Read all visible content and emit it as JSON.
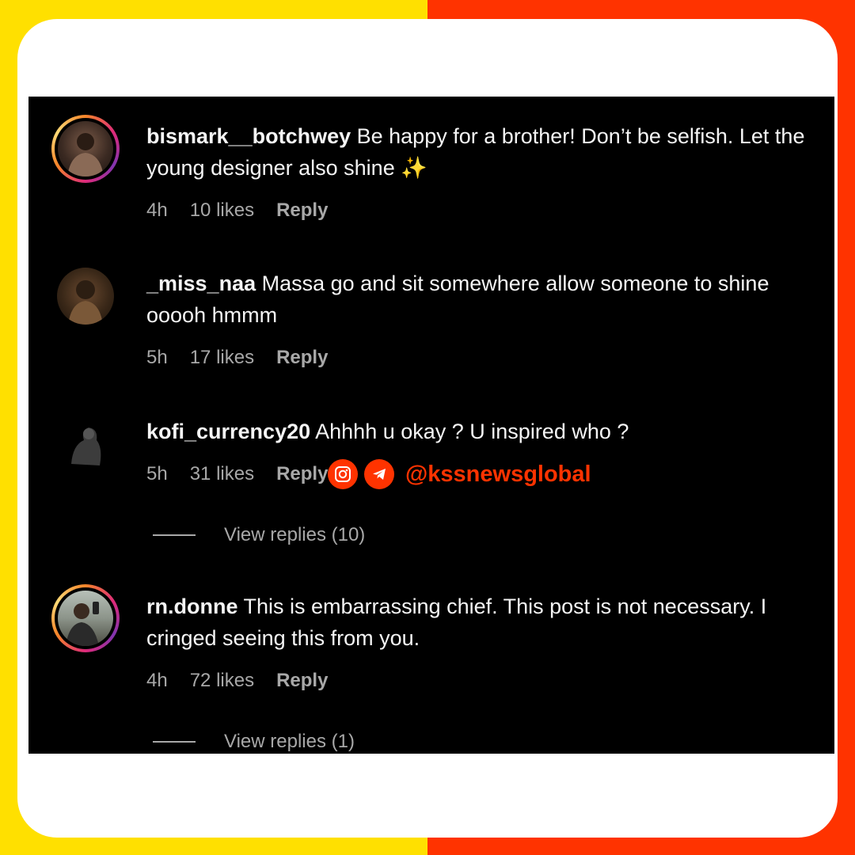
{
  "colors": {
    "left_background": "#FFE000",
    "right_background": "#FF3300",
    "accent": "#FF3300",
    "meta_text": "#a8a8a8"
  },
  "comments": [
    {
      "username": "bismark__botchwey",
      "text": "Be happy for a brother! Don’t be selfish. Let the young designer also shine ✨",
      "time": "4h",
      "likes": "10 likes",
      "reply": "Reply",
      "story_ring": true
    },
    {
      "username": "_miss_naa",
      "text": "Massa go and sit somewhere allow someone to shine ooooh hmmm",
      "time": "5h",
      "likes": "17 likes",
      "reply": "Reply",
      "story_ring": false
    },
    {
      "username": "kofi_currency20",
      "text": "Ahhhh u okay ? U inspired who ?",
      "time": "5h",
      "likes": "31 likes",
      "reply": "Reply",
      "story_ring": false,
      "view_replies": "View replies (10)"
    },
    {
      "username": "rn.donne",
      "text": "This is embarrassing chief. This post is not necessary. I cringed seeing this from you.",
      "time": "4h",
      "likes": "72 likes",
      "reply": "Reply",
      "story_ring": true,
      "view_replies": "View replies (1)"
    }
  ],
  "watermark": {
    "handle": "@kssnewsglobal",
    "icons": [
      "instagram-icon",
      "telegram-icon"
    ]
  }
}
